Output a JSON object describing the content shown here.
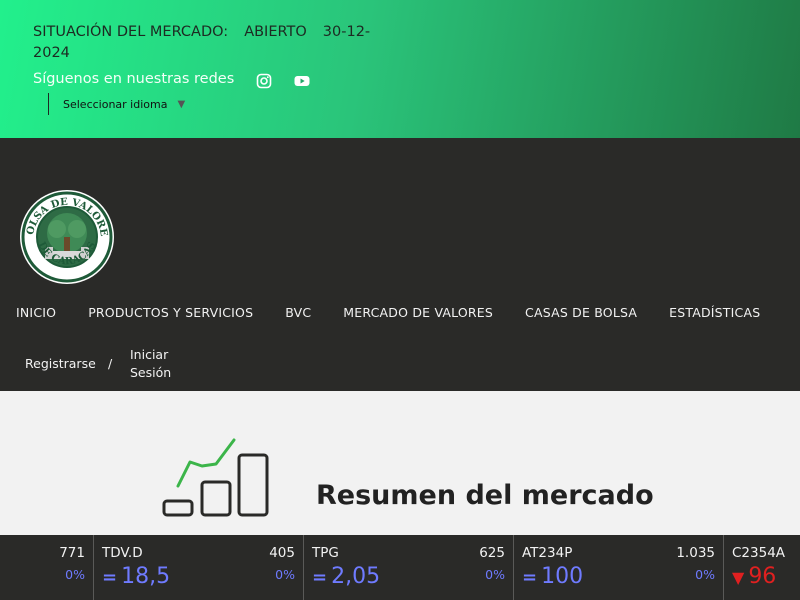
{
  "header": {
    "market_label": "SITUACIÓN DEL MERCADO:",
    "market_state": "ABIERTO",
    "market_date": "30-12-2024",
    "social_label": "Síguenos en nuestras redes",
    "social_icons": [
      "instagram-icon",
      "youtube-icon"
    ],
    "language_select": "Seleccionar idioma",
    "language_caret": "▼"
  },
  "logo": {
    "top_text": "BOLSA DE VALORES",
    "bottom_text": "DE CARACAS"
  },
  "nav": {
    "items": [
      "INICIO",
      "PRODUCTOS Y SERVICIOS",
      "BVC",
      "MERCADO DE VALORES",
      "CASAS DE BOLSA",
      "ESTADÍSTICAS"
    ]
  },
  "auth": {
    "register": "Registrarse",
    "separator": "/",
    "login": "Iniciar Sesión"
  },
  "main": {
    "title": "Resumen del mercado"
  },
  "ticker": {
    "partial_first": {
      "volume": "771",
      "change": "0%"
    },
    "items": [
      {
        "symbol": "TDV.D",
        "volume": "405",
        "change": "0%",
        "price": "18,5",
        "trend": "="
      },
      {
        "symbol": "TPG",
        "volume": "625",
        "change": "0%",
        "price": "2,05",
        "trend": "="
      },
      {
        "symbol": "AT234P",
        "volume": "1.035",
        "change": "0%",
        "price": "100",
        "trend": "="
      },
      {
        "symbol": "C2354A",
        "volume": "",
        "change": "",
        "price": "96",
        "trend": "▼"
      }
    ]
  },
  "colors": {
    "banner_start": "#22f08c",
    "banner_end": "#1f7a45",
    "dark_bg": "#2a2a28",
    "light_bg": "#f2f2f2",
    "neutral_price": "#6f7bff",
    "down_price": "#e02020",
    "chart_green": "#3cb54a"
  }
}
